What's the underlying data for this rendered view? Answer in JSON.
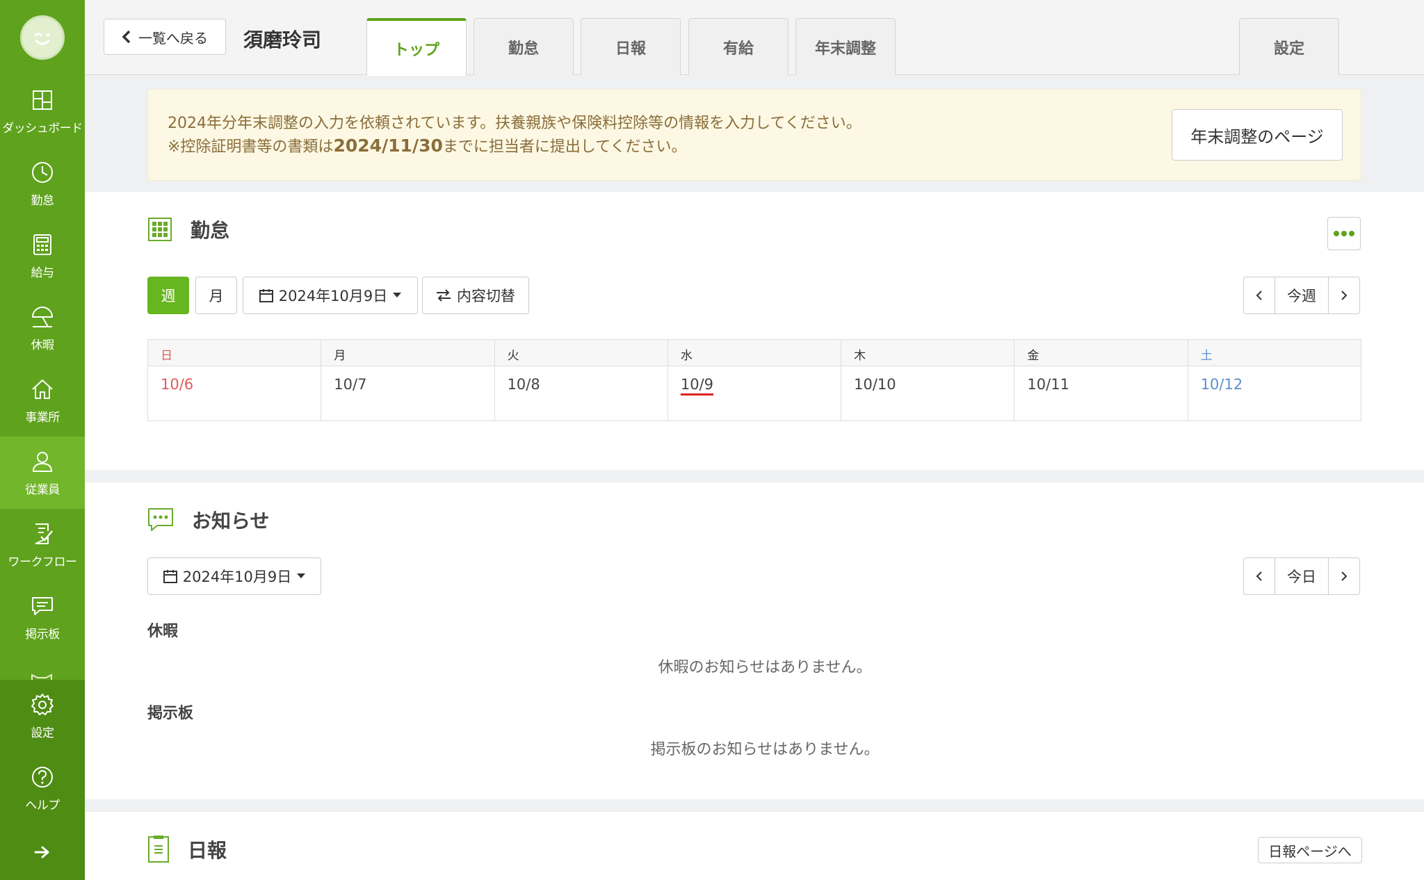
{
  "sidebar": {
    "items": [
      {
        "label": "ダッシュボード",
        "icon": "dashboard-icon"
      },
      {
        "label": "勤怠",
        "icon": "clock-icon"
      },
      {
        "label": "給与",
        "icon": "calculator-icon"
      },
      {
        "label": "休暇",
        "icon": "umbrella-icon"
      },
      {
        "label": "事業所",
        "icon": "home-icon"
      },
      {
        "label": "従業員",
        "icon": "person-icon"
      },
      {
        "label": "ワークフロー",
        "icon": "checklist-icon"
      },
      {
        "label": "掲示板",
        "icon": "chat-icon"
      }
    ],
    "bottom": [
      {
        "label": "設定",
        "icon": "gear-icon"
      },
      {
        "label": "ヘルプ",
        "icon": "help-icon"
      }
    ]
  },
  "header": {
    "back_label": "一覧へ戻る",
    "person_name": "須磨玲司",
    "tabs": [
      "トップ",
      "勤怠",
      "日報",
      "有給",
      "年末調整"
    ],
    "settings_tab": "設定"
  },
  "notice": {
    "line1": "2024年分年末調整の入力を依頼されています。扶養親族や保険料控除等の情報を入力してください。",
    "line2_prefix": "※控除証明書等の書類は",
    "line2_date": "2024/11/30",
    "line2_suffix": "までに担当者に提出してください。",
    "button": "年末調整のページ"
  },
  "attendance": {
    "title": "勤怠",
    "week_btn": "週",
    "month_btn": "月",
    "date_btn": "2024年10月9日",
    "toggle_btn": "内容切替",
    "pager_label": "今週",
    "days": [
      {
        "head": "日",
        "date": "10/6"
      },
      {
        "head": "月",
        "date": "10/7"
      },
      {
        "head": "火",
        "date": "10/8"
      },
      {
        "head": "水",
        "date": "10/9"
      },
      {
        "head": "木",
        "date": "10/10"
      },
      {
        "head": "金",
        "date": "10/11"
      },
      {
        "head": "土",
        "date": "10/12"
      }
    ]
  },
  "news": {
    "title": "お知らせ",
    "date_btn": "2024年10月9日",
    "pager_label": "今日",
    "vacation_heading": "休暇",
    "vacation_empty": "休暇のお知らせはありません。",
    "board_heading": "掲示板",
    "board_empty": "掲示板のお知らせはありません。"
  },
  "daily_report": {
    "title": "日報",
    "button": "日報ページへ"
  },
  "colors": {
    "brand_green": "#5fa21d",
    "notice_bg": "#fcf8e3",
    "sunday": "#e05a5a",
    "saturday": "#5b8fd0"
  }
}
